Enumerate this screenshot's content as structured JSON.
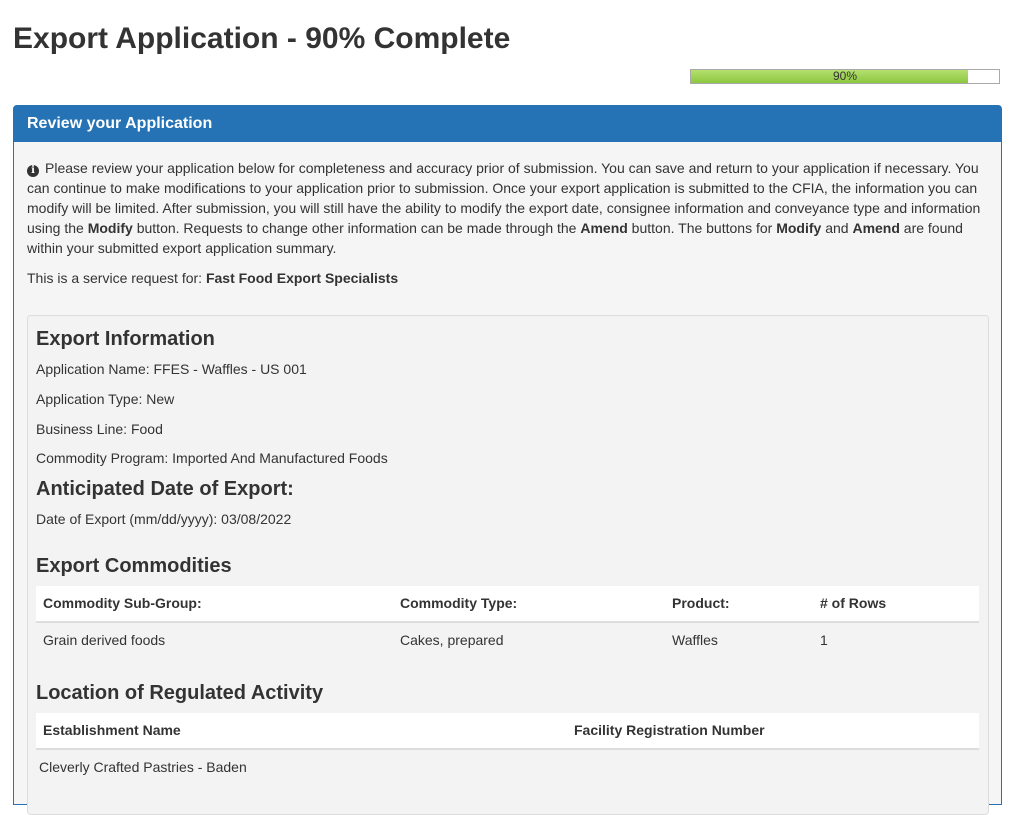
{
  "page": {
    "title": "Export Application - 90% Complete",
    "progress": {
      "value": 0.9,
      "label": "90%"
    }
  },
  "panel": {
    "heading": "Review your Application",
    "info_parts": {
      "p1": "Please review your application below for completeness and accuracy prior of submission. You can save and return to your application if necessary. You can continue to make modifications to your application prior to submission. Once your export application is submitted to the CFIA, the information you can modify will be limited. After submission, you will still have the ability to modify the export date, consignee information and conveyance type and information using the ",
      "b1": "Modify",
      "p2": " button. Requests to change other information can be made through the ",
      "b2": "Amend",
      "p3": " button. The buttons for ",
      "b3": "Modify",
      "p4": " and ",
      "b4": "Amend",
      "p5": " are found within your submitted export application summary."
    },
    "service_request_label": "This is a service request for:",
    "service_request_company": "Fast Food Export Specialists"
  },
  "export_info": {
    "heading": "Export Information",
    "application_name": "Application Name: FFES - Waffles - US 001",
    "application_type": "Application Type: New",
    "business_line": "Business Line: Food",
    "commodity_program": "Commodity Program: Imported And Manufactured Foods"
  },
  "anticipated_date": {
    "heading": "Anticipated Date of Export:",
    "date_line": "Date of Export (mm/dd/yyyy): 03/08/2022"
  },
  "export_commodities": {
    "heading": "Export Commodities",
    "columns": [
      "Commodity Sub-Group:",
      "Commodity Type:",
      "Product:",
      "# of Rows"
    ],
    "rows": [
      [
        "Grain derived foods",
        "Cakes, prepared",
        "Waffles",
        "1"
      ]
    ]
  },
  "regulated_activity": {
    "heading": "Location of Regulated Activity",
    "columns": [
      "Establishment Name",
      "Facility Registration Number"
    ],
    "rows": [
      [
        "Cleverly Crafted Pastries - Baden",
        ""
      ]
    ]
  },
  "colors": {
    "panel_blue": "#2572b4",
    "progress_green": "#8cc63f"
  }
}
